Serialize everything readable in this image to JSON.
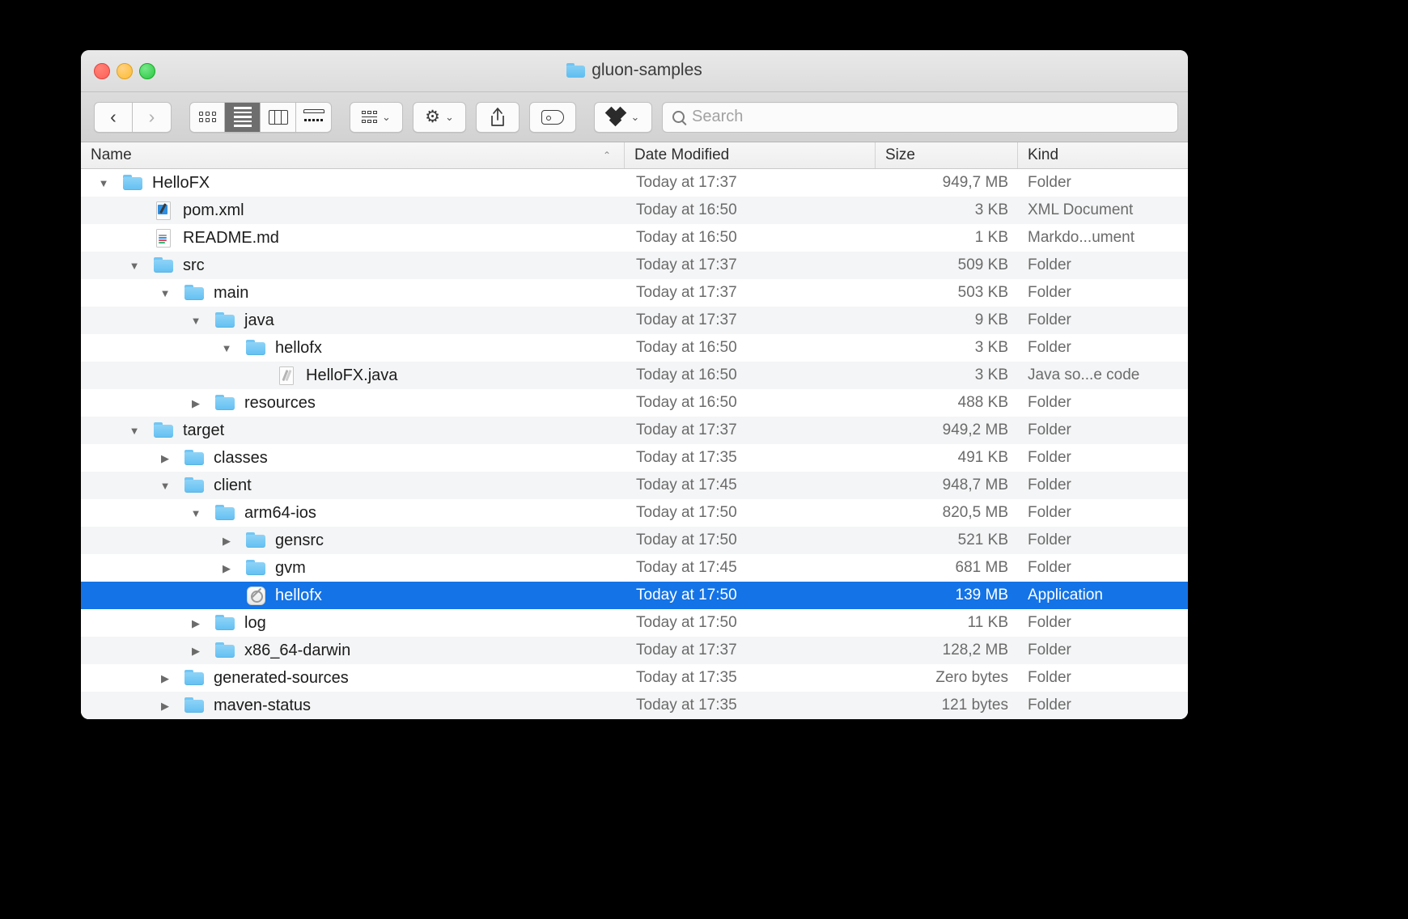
{
  "window": {
    "title": "gluon-samples",
    "title_icon": "folder-icon",
    "traffic_lights": [
      {
        "name": "close-button",
        "color": "#ff5f57"
      },
      {
        "name": "minimize-button",
        "color": "#febc2e"
      },
      {
        "name": "maximize-button",
        "color": "#28c840"
      }
    ]
  },
  "toolbar": {
    "back_label": "‹",
    "forward_label": "›",
    "view_buttons": [
      {
        "name": "view-icon-grid",
        "icon": "grid-view-icon",
        "active": false
      },
      {
        "name": "view-list",
        "icon": "list-view-icon",
        "active": true
      },
      {
        "name": "view-columns",
        "icon": "column-view-icon",
        "active": false
      },
      {
        "name": "view-gallery",
        "icon": "gallery-view-icon",
        "active": false
      }
    ],
    "group_by": {
      "name": "group-by-button",
      "icon": "group-by-icon",
      "chevron": "⌄"
    },
    "action": {
      "name": "action-gear-button",
      "icon": "gear-icon",
      "glyph": "⚙",
      "chevron": "⌄"
    },
    "share": {
      "name": "share-button",
      "icon": "share-icon"
    },
    "tag": {
      "name": "tag-button",
      "icon": "tag-icon"
    },
    "dropbox": {
      "name": "dropbox-button",
      "icon": "dropbox-icon",
      "chevron": "⌄"
    },
    "search": {
      "name": "search-input",
      "placeholder": "Search",
      "icon": "search-icon",
      "value": ""
    }
  },
  "columns": [
    {
      "key": "name",
      "label": "Name",
      "sorted": true,
      "sort_caret": "⌃"
    },
    {
      "key": "date",
      "label": "Date Modified"
    },
    {
      "key": "size",
      "label": "Size"
    },
    {
      "key": "kind",
      "label": "Kind"
    }
  ],
  "rows": [
    {
      "name": "HelloFX",
      "depth": 0,
      "twisty": "open",
      "icon": "folder-icon",
      "date": "Today at 17:37",
      "size": "949,7 MB",
      "kind": "Folder",
      "selected": false
    },
    {
      "name": "pom.xml",
      "depth": 1,
      "twisty": "none",
      "icon": "xml-document-icon",
      "date": "Today at 16:50",
      "size": "3 KB",
      "kind": "XML Document",
      "selected": false
    },
    {
      "name": "README.md",
      "depth": 1,
      "twisty": "none",
      "icon": "markdown-document-icon",
      "date": "Today at 16:50",
      "size": "1 KB",
      "kind": "Markdo...ument",
      "selected": false
    },
    {
      "name": "src",
      "depth": 1,
      "twisty": "open",
      "icon": "folder-icon",
      "date": "Today at 17:37",
      "size": "509 KB",
      "kind": "Folder",
      "selected": false
    },
    {
      "name": "main",
      "depth": 2,
      "twisty": "open",
      "icon": "folder-icon",
      "date": "Today at 17:37",
      "size": "503 KB",
      "kind": "Folder",
      "selected": false
    },
    {
      "name": "java",
      "depth": 3,
      "twisty": "open",
      "icon": "folder-icon",
      "date": "Today at 17:37",
      "size": "9 KB",
      "kind": "Folder",
      "selected": false
    },
    {
      "name": "hellofx",
      "depth": 4,
      "twisty": "open",
      "icon": "folder-icon",
      "date": "Today at 16:50",
      "size": "3 KB",
      "kind": "Folder",
      "selected": false
    },
    {
      "name": "HelloFX.java",
      "depth": 5,
      "twisty": "none",
      "icon": "java-source-icon",
      "date": "Today at 16:50",
      "size": "3 KB",
      "kind": "Java so...e code",
      "selected": false
    },
    {
      "name": "resources",
      "depth": 3,
      "twisty": "closed",
      "icon": "folder-icon",
      "date": "Today at 16:50",
      "size": "488 KB",
      "kind": "Folder",
      "selected": false
    },
    {
      "name": "target",
      "depth": 1,
      "twisty": "open",
      "icon": "folder-icon",
      "date": "Today at 17:37",
      "size": "949,2 MB",
      "kind": "Folder",
      "selected": false
    },
    {
      "name": "classes",
      "depth": 2,
      "twisty": "closed",
      "icon": "folder-icon",
      "date": "Today at 17:35",
      "size": "491 KB",
      "kind": "Folder",
      "selected": false
    },
    {
      "name": "client",
      "depth": 2,
      "twisty": "open",
      "icon": "folder-icon",
      "date": "Today at 17:45",
      "size": "948,7 MB",
      "kind": "Folder",
      "selected": false
    },
    {
      "name": "arm64-ios",
      "depth": 3,
      "twisty": "open",
      "icon": "folder-icon",
      "date": "Today at 17:50",
      "size": "820,5 MB",
      "kind": "Folder",
      "selected": false
    },
    {
      "name": "gensrc",
      "depth": 4,
      "twisty": "closed",
      "icon": "folder-icon",
      "date": "Today at 17:50",
      "size": "521 KB",
      "kind": "Folder",
      "selected": false
    },
    {
      "name": "gvm",
      "depth": 4,
      "twisty": "closed",
      "icon": "folder-icon",
      "date": "Today at 17:45",
      "size": "681 MB",
      "kind": "Folder",
      "selected": false
    },
    {
      "name": "hellofx",
      "depth": 4,
      "twisty": "none",
      "icon": "prohibited-app-icon",
      "date": "Today at 17:50",
      "size": "139 MB",
      "kind": "Application",
      "selected": true
    },
    {
      "name": "log",
      "depth": 3,
      "twisty": "closed",
      "icon": "folder-icon",
      "date": "Today at 17:50",
      "size": "11 KB",
      "kind": "Folder",
      "selected": false
    },
    {
      "name": "x86_64-darwin",
      "depth": 3,
      "twisty": "closed",
      "icon": "folder-icon",
      "date": "Today at 17:37",
      "size": "128,2 MB",
      "kind": "Folder",
      "selected": false
    },
    {
      "name": "generated-sources",
      "depth": 2,
      "twisty": "closed",
      "icon": "folder-icon",
      "date": "Today at 17:35",
      "size": "Zero bytes",
      "kind": "Folder",
      "selected": false
    },
    {
      "name": "maven-status",
      "depth": 2,
      "twisty": "closed",
      "icon": "folder-icon",
      "date": "Today at 17:35",
      "size": "121 bytes",
      "kind": "Folder",
      "selected": false
    }
  ],
  "colors": {
    "selection": "#1473e6",
    "folder": "#62c0f2",
    "stripe": "#f4f5f6",
    "toolbar": "#d2d2d2"
  }
}
